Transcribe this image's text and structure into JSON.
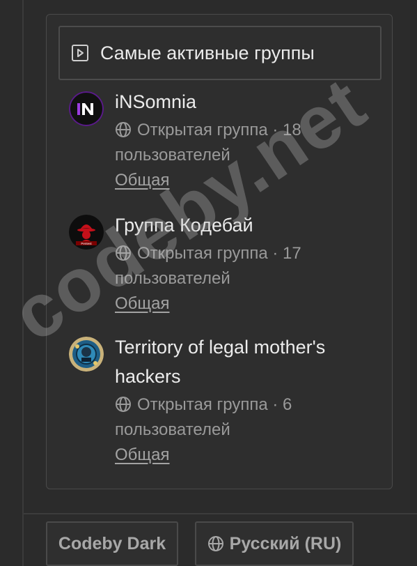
{
  "widget": {
    "title": "Самые активные группы",
    "header_icon": "play-square-icon"
  },
  "groups": [
    {
      "name": "iNSomnia",
      "meta": "Открытая группа · 18 пользователей",
      "tag": "Общая",
      "avatar_icon": "insomnia-logo"
    },
    {
      "name": "Группа Кодебай",
      "meta": "Открытая группа · 17 пользователей",
      "tag": "Общая",
      "avatar_icon": "hacker-hat-logo",
      "avatar_caption": "Pentest"
    },
    {
      "name": "Territory of legal mother's hackers",
      "meta": "Открытая группа · 6 пользователей",
      "tag": "Общая",
      "avatar_icon": "circuit-badge-logo"
    }
  ],
  "footer": {
    "theme_label": "Codeby Dark",
    "language_label": "Русский (RU)"
  },
  "watermark": "codeby.net",
  "colors": {
    "background": "#2b2b2b",
    "border": "#4a4a4a",
    "text": "#ececec",
    "muted": "#9a9a9a"
  }
}
